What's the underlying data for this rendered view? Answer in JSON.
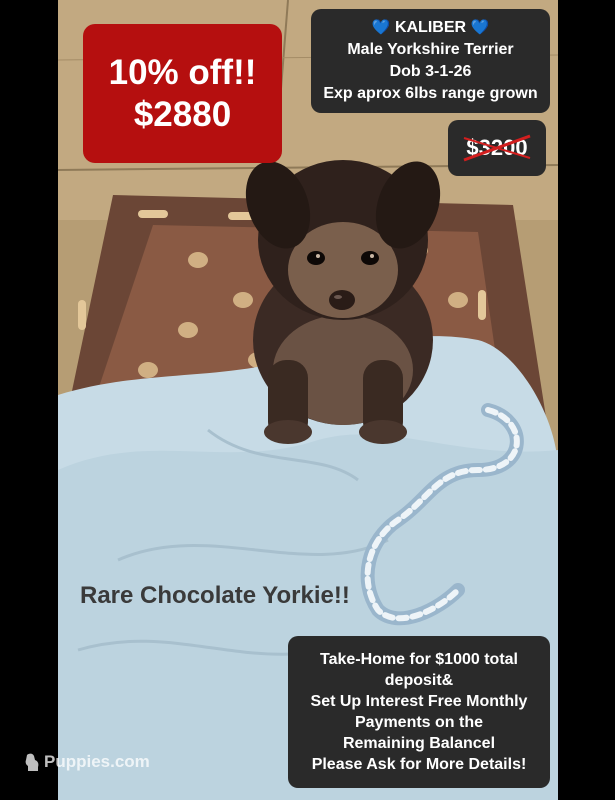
{
  "price_badge": {
    "discount": "10% off!!",
    "price": "$2880",
    "color": "#b50f0f"
  },
  "info_box": {
    "name_line": "KALIBER",
    "breed": "Male Yorkshire Terrier",
    "dob": "Dob 3-1-26",
    "expected_size": "Exp aprox 6lbs range grown",
    "heart_icon": "blue-heart-icon"
  },
  "old_price": {
    "price": "$3200"
  },
  "caption": {
    "text": "Rare Chocolate Yorkie!!"
  },
  "details_box": {
    "line1": "Take-Home for $1000 total",
    "line2": "deposit&",
    "line3": "Set Up Interest Free Monthly",
    "line4": "Payments on the",
    "line5": "Remaining Balancel",
    "line6": "Please Ask for More Details!"
  },
  "watermark": {
    "text": "Puppies.com"
  }
}
